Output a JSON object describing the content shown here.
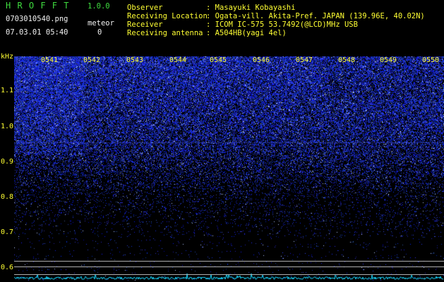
{
  "header": {
    "app_name": "H R O F F T",
    "version": "1.0.0",
    "filename": "0703010540.png",
    "meteor_label": "meteor",
    "datetime": "07.03.01 05:40",
    "meteor_count": "0",
    "info_rows": [
      {
        "label": "Observer",
        "value": ": Masayuki Kobayashi"
      },
      {
        "label": "Receiving Location",
        "value": ": Ogata-vill. Akita-Pref. JAPAN (139.96E, 40.02N)"
      },
      {
        "label": "Receiver",
        "value": ": ICOM IC-575 53.7492(@LCD)MHz USB"
      },
      {
        "label": "Receiving antenna",
        "value": ": A504HB(yagi 4el)"
      }
    ]
  },
  "spectrogram": {
    "unit_label": "kHz",
    "freq_ticks": [
      "1.1",
      "1.0",
      "0.9",
      "0.8",
      "0.7",
      "0.6"
    ],
    "time_ticks": [
      "0541",
      "0542",
      "0543",
      "0544",
      "0545",
      "0546",
      "0547",
      "0548",
      "0549",
      "0550"
    ],
    "colors": {
      "noise": "#2a3cff",
      "background": "#000000",
      "trace": "#19d8ff",
      "axis": "#ffff33"
    }
  }
}
